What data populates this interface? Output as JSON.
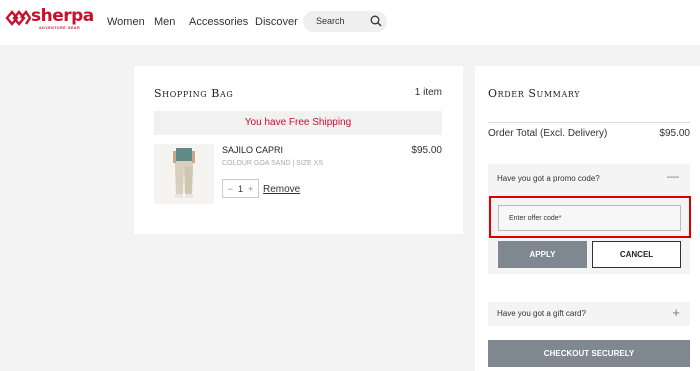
{
  "header": {
    "logo_word": "sherpa",
    "logo_tagline": "ADVENTURE GEAR",
    "nav": [
      "Women",
      "Men",
      "Accessories",
      "Discover"
    ],
    "search_placeholder": "Search"
  },
  "bag": {
    "title": "Shopping Bag",
    "count": "1 item",
    "shipping_banner": "You have Free Shipping",
    "item": {
      "name": "SAJILO CAPRI",
      "meta": "COLOUR GOA SAND | SIZE XS",
      "price": "$95.00",
      "qty_minus": "−",
      "qty": "1",
      "qty_plus": "+",
      "remove": "Remove"
    }
  },
  "summary": {
    "title": "Order Summary",
    "total_label": "Order Total (Excl. Delivery)",
    "total_value": "$95.00",
    "promo_question": "Have you got a promo code?",
    "promo_toggle": "—",
    "offer_placeholder": "Enter offer code",
    "offer_required": "*",
    "apply": "APPLY",
    "cancel": "CANCEL",
    "gift_question": "Have you got a gift card?",
    "gift_toggle": "+",
    "checkout": "CHECKOUT SECURELY"
  },
  "colors": {
    "brand": "#c8102e",
    "button_gray": "#7f8790",
    "highlight": "#d90000"
  }
}
